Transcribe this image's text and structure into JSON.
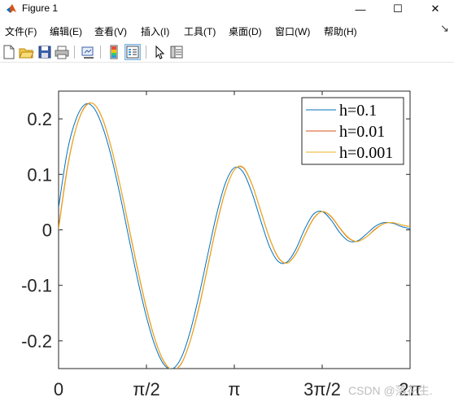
{
  "window": {
    "title": "Figure 1",
    "min_symbol": "—",
    "max_symbol": "☐",
    "close_symbol": "✕"
  },
  "menu": [
    "文件(F)",
    "编辑(E)",
    "查看(V)",
    "插入(I)",
    "工具(T)",
    "桌面(D)",
    "窗口(W)",
    "帮助(H)"
  ],
  "menu_overflow": "↘",
  "toolbar": [
    "new-figure-icon",
    "open-file-icon",
    "save-icon",
    "print-icon",
    "link-plot-icon",
    "colorbar-icon",
    "legend-icon",
    "pointer-icon",
    "property-inspector-icon"
  ],
  "watermark": "CSDN @落花生.",
  "colors": {
    "series1": "#0072BD",
    "series2": "#D95319",
    "series3": "#EDB120"
  },
  "chart_data": {
    "type": "line",
    "title": "",
    "xlabel": "",
    "ylabel": "",
    "xlim": [
      0,
      6.283185
    ],
    "ylim": [
      -0.25,
      0.25
    ],
    "xticks": [
      0,
      1.570796,
      3.141593,
      4.712389,
      6.283185
    ],
    "xtick_labels": [
      "0",
      "π/2",
      "π",
      "3π/2",
      "2π"
    ],
    "yticks": [
      0.2,
      0.1,
      0,
      -0.1,
      -0.2
    ],
    "ytick_labels": [
      "0.2",
      "0.1",
      "0",
      "-0.1",
      "-0.2"
    ],
    "legend_position": "top-right",
    "series": [
      {
        "name": "h=0.1",
        "color": "#0072BD",
        "x": [
          0,
          0.157,
          0.314,
          0.471,
          0.628,
          0.785,
          0.942,
          1.1,
          1.257,
          1.414,
          1.571,
          1.728,
          1.885,
          2.042,
          2.199,
          2.356,
          2.513,
          2.67,
          2.827,
          2.985,
          3.142,
          3.299,
          3.456,
          3.613,
          3.77,
          3.927,
          4.084,
          4.241,
          4.398,
          4.555,
          4.712,
          4.869,
          5.027,
          5.184,
          5.341,
          5.498,
          5.655,
          5.812,
          5.969,
          6.126,
          6.283
        ],
        "values": [
          0.04,
          0.142,
          0.2,
          0.226,
          0.22,
          0.186,
          0.132,
          0.062,
          -0.015,
          -0.09,
          -0.157,
          -0.21,
          -0.243,
          -0.25,
          -0.229,
          -0.182,
          -0.117,
          -0.043,
          0.029,
          0.085,
          0.112,
          0.104,
          0.067,
          0.017,
          -0.03,
          -0.057,
          -0.058,
          -0.035,
          0.001,
          0.028,
          0.033,
          0.018,
          -0.005,
          -0.02,
          -0.02,
          -0.008,
          0.006,
          0.013,
          0.012,
          0.006,
          0.002
        ]
      },
      {
        "name": "h=0.01",
        "color": "#D95319",
        "x": [
          0,
          0.157,
          0.314,
          0.471,
          0.628,
          0.785,
          0.942,
          1.1,
          1.257,
          1.414,
          1.571,
          1.728,
          1.885,
          2.042,
          2.199,
          2.356,
          2.513,
          2.67,
          2.827,
          2.985,
          3.142,
          3.299,
          3.456,
          3.613,
          3.77,
          3.927,
          4.084,
          4.241,
          4.398,
          4.555,
          4.712,
          4.869,
          5.027,
          5.184,
          5.341,
          5.498,
          5.655,
          5.812,
          5.969,
          6.126,
          6.283
        ],
        "values": [
          0.004,
          0.112,
          0.184,
          0.222,
          0.227,
          0.2,
          0.148,
          0.08,
          0.004,
          -0.072,
          -0.142,
          -0.199,
          -0.238,
          -0.252,
          -0.24,
          -0.199,
          -0.138,
          -0.064,
          0.01,
          0.071,
          0.108,
          0.112,
          0.082,
          0.034,
          -0.015,
          -0.05,
          -0.06,
          -0.043,
          -0.01,
          0.02,
          0.033,
          0.024,
          0.003,
          -0.015,
          -0.021,
          -0.013,
          0.001,
          0.011,
          0.013,
          0.009,
          0.006
        ]
      },
      {
        "name": "h=0.001",
        "color": "#EDB120",
        "x": [
          0,
          0.157,
          0.314,
          0.471,
          0.628,
          0.785,
          0.942,
          1.1,
          1.257,
          1.414,
          1.571,
          1.728,
          1.885,
          2.042,
          2.199,
          2.356,
          2.513,
          2.67,
          2.827,
          2.985,
          3.142,
          3.299,
          3.456,
          3.613,
          3.77,
          3.927,
          4.084,
          4.241,
          4.398,
          4.555,
          4.712,
          4.869,
          5.027,
          5.184,
          5.341,
          5.498,
          5.655,
          5.812,
          5.969,
          6.126,
          6.283
        ],
        "values": [
          0.0,
          0.109,
          0.183,
          0.221,
          0.227,
          0.201,
          0.149,
          0.081,
          0.006,
          -0.07,
          -0.14,
          -0.198,
          -0.237,
          -0.252,
          -0.241,
          -0.2,
          -0.14,
          -0.066,
          0.008,
          0.07,
          0.108,
          0.113,
          0.083,
          0.035,
          -0.014,
          -0.049,
          -0.06,
          -0.044,
          -0.011,
          0.019,
          0.033,
          0.025,
          0.004,
          -0.014,
          -0.021,
          -0.013,
          0.0,
          0.011,
          0.013,
          0.009,
          0.006
        ]
      }
    ]
  }
}
